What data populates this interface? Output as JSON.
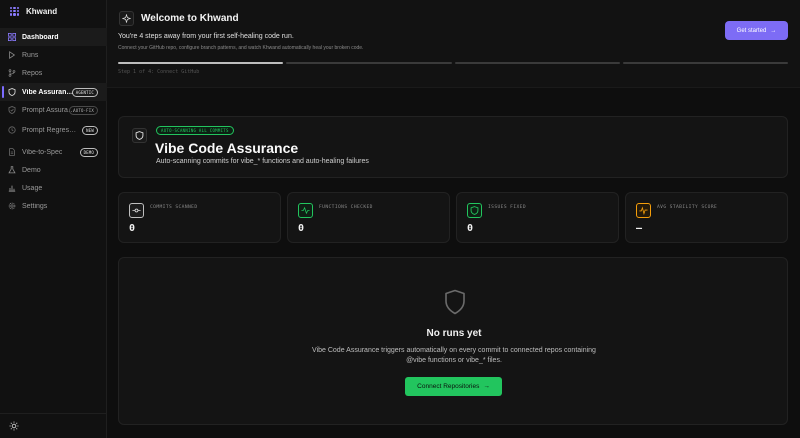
{
  "app": {
    "name": "Khwand"
  },
  "sidebar": {
    "items": [
      {
        "label": "Dashboard",
        "icon": "grid-icon",
        "badge": ""
      },
      {
        "label": "Runs",
        "icon": "play-icon",
        "badge": ""
      },
      {
        "label": "Repos",
        "icon": "branch-icon",
        "badge": ""
      },
      {
        "label": "Vibe Assuran…",
        "icon": "shield-icon",
        "badge": "AGENTIC"
      },
      {
        "label": "Prompt Assura…",
        "icon": "shield-check-icon",
        "badge": "AUTO-FIX"
      },
      {
        "label": "Prompt Regressi…",
        "icon": "clock-icon",
        "badge": "NEW"
      },
      {
        "label": "Vibe-to-Spec",
        "icon": "document-icon",
        "badge": "DEMO"
      },
      {
        "label": "Demo",
        "icon": "flask-icon",
        "badge": ""
      },
      {
        "label": "Usage",
        "icon": "bar-chart-icon",
        "badge": ""
      },
      {
        "label": "Settings",
        "icon": "gear-icon",
        "badge": ""
      }
    ],
    "theme_toggle_icon": "sun-icon"
  },
  "welcome": {
    "title": "Welcome to Khwand",
    "subtitle": "You're 4 steps away from your first self-healing code run.",
    "description": "Connect your GitHub repo, configure branch patterns, and watch Khwand automatically heal your broken code.",
    "cta": "Get started",
    "step_text": "Step 1 of 4: Connect GitHub",
    "steps_total": 4,
    "steps_done": 0
  },
  "hero": {
    "pill": "AUTO-SCANNING ALL COMMITS",
    "title": "Vibe Code Assurance",
    "subtitle": "Auto-scanning commits for vibe_* functions and auto-healing failures"
  },
  "stats": [
    {
      "label": "COMMITS SCANNED",
      "value": "0",
      "icon": "git-commit-icon",
      "color": "#cfcfcf"
    },
    {
      "label": "FUNCTIONS CHECKED",
      "value": "0",
      "icon": "activity-icon",
      "color": "#22c55e"
    },
    {
      "label": "ISSUES FIXED",
      "value": "0",
      "icon": "shield-icon",
      "color": "#22c55e"
    },
    {
      "label": "AVG STABILITY SCORE",
      "value": "—",
      "icon": "pulse-icon",
      "color": "#f59e0b"
    }
  ],
  "empty": {
    "title": "No runs yet",
    "description": "Vibe Code Assurance triggers automatically on every commit to connected repos containing @vibe functions or vibe_* files.",
    "cta": "Connect Repositories"
  },
  "colors": {
    "accent": "#7d6cf5",
    "success": "#22c55e",
    "warning": "#f59e0b"
  }
}
